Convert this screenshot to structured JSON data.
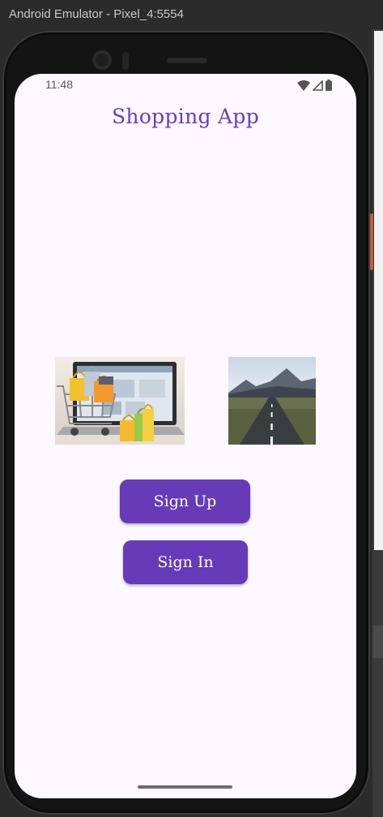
{
  "window": {
    "title": "Android Emulator - Pixel_4:5554"
  },
  "statusbar": {
    "time": "11:48",
    "icons": [
      "wifi-icon",
      "signal-icon",
      "battery-icon"
    ]
  },
  "app": {
    "title": "Shopping App"
  },
  "images": [
    {
      "name": "shopping-cart-laptop-image"
    },
    {
      "name": "mountain-road-image"
    }
  ],
  "buttons": {
    "sign_up": "Sign Up",
    "sign_in": "Sign In"
  },
  "colors": {
    "accent": "#673ab7",
    "title": "#6a3db6",
    "background": "#fdf7ff"
  }
}
